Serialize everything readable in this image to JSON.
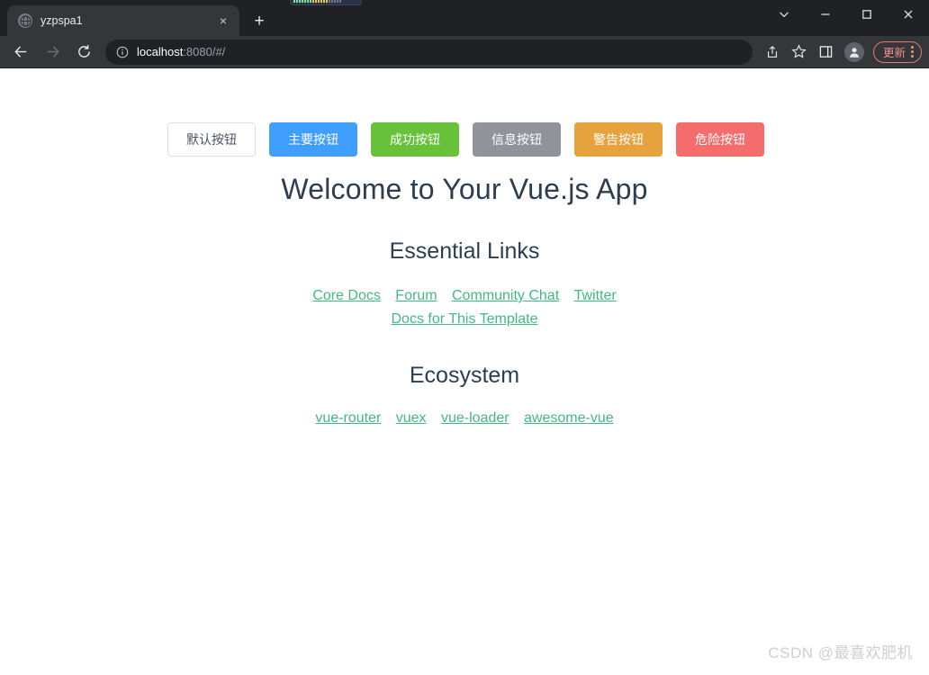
{
  "window": {
    "controls": [
      {
        "name": "tab-search",
        "glyph": "chevron-down"
      },
      {
        "name": "minimize",
        "glyph": "minimize"
      },
      {
        "name": "maximize",
        "glyph": "maximize"
      },
      {
        "name": "close",
        "glyph": "close"
      }
    ]
  },
  "tab": {
    "title": "yzpspa1",
    "favicon": "globe-icon",
    "close_label": "×",
    "new_tab_label": "+"
  },
  "toolbar": {
    "back_label": "←",
    "forward_label": "→",
    "reload_label": "↻",
    "site_info_icon": "info-icon",
    "url_host": "localhost",
    "url_rest": ":8080/#/",
    "url_full": "localhost:8080/#/",
    "share_icon": "share-icon",
    "bookmark_icon": "star-icon",
    "sidepanel_icon": "side-panel-icon",
    "profile_icon": "profile-avatar-icon",
    "update_label": "更新",
    "menu_icon": "kebab-menu-icon"
  },
  "page": {
    "buttons": [
      {
        "label": "默认按钮",
        "type": "default",
        "color": "#ffffff",
        "name": "default-button"
      },
      {
        "label": "主要按钮",
        "type": "primary",
        "color": "#409EFF",
        "name": "primary-button"
      },
      {
        "label": "成功按钮",
        "type": "success",
        "color": "#67C23A",
        "name": "success-button"
      },
      {
        "label": "信息按钮",
        "type": "info",
        "color": "#909399",
        "name": "info-button"
      },
      {
        "label": "警告按钮",
        "type": "warning",
        "color": "#E6A23C",
        "name": "warning-button"
      },
      {
        "label": "危险按钮",
        "type": "danger",
        "color": "#F56C6C",
        "name": "danger-button"
      }
    ],
    "heading": "Welcome to Your Vue.js App",
    "essential": {
      "title": "Essential Links",
      "links": [
        "Core Docs",
        "Forum",
        "Community Chat",
        "Twitter",
        "Docs for This Template"
      ]
    },
    "ecosystem": {
      "title": "Ecosystem",
      "links": [
        "vue-router",
        "vuex",
        "vue-loader",
        "awesome-vue"
      ]
    },
    "link_color": "#42b983",
    "heading_color": "#2c3e50",
    "watermark": "CSDN @最喜欢肥机"
  }
}
